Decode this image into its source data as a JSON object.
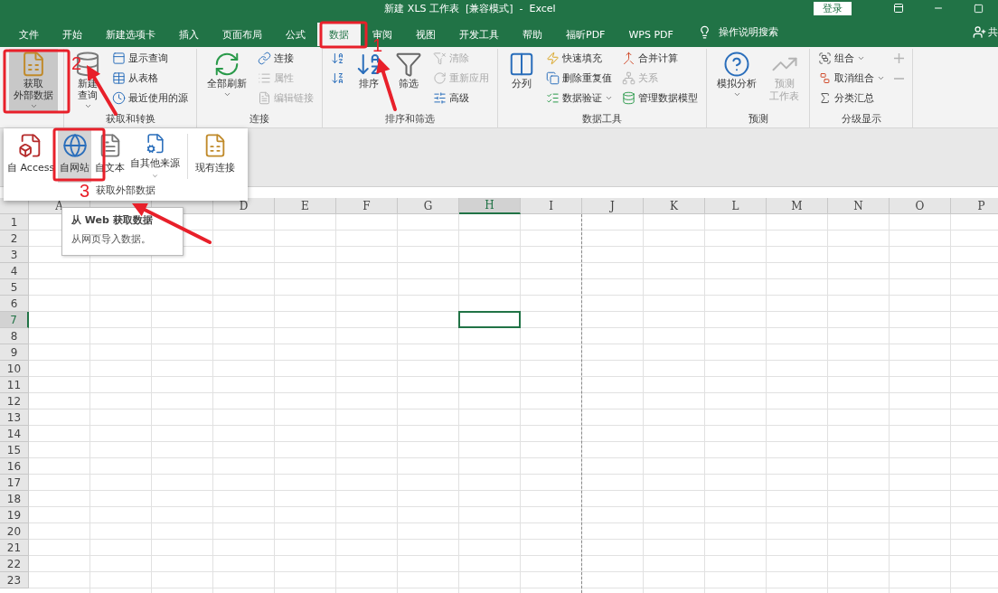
{
  "window": {
    "title": "新建 XLS 工作表  [兼容模式]  -  Excel",
    "login": "登录"
  },
  "tabs": [
    {
      "label": "文件",
      "selected": false
    },
    {
      "label": "开始",
      "selected": false
    },
    {
      "label": "新建选项卡",
      "selected": false
    },
    {
      "label": "插入",
      "selected": false
    },
    {
      "label": "页面布局",
      "selected": false
    },
    {
      "label": "公式",
      "selected": false
    },
    {
      "label": "数据",
      "selected": true
    },
    {
      "label": "审阅",
      "selected": false
    },
    {
      "label": "视图",
      "selected": false
    },
    {
      "label": "开发工具",
      "selected": false
    },
    {
      "label": "帮助",
      "selected": false
    },
    {
      "label": "福昕PDF",
      "selected": false
    },
    {
      "label": "WPS PDF",
      "selected": false
    }
  ],
  "tell_me": "操作说明搜索",
  "share": "共",
  "ribbon": [
    {
      "blocks": [
        {
          "kind": "large",
          "lines": [
            "获取",
            "外部数据"
          ],
          "dropdown": true,
          "disabled": false,
          "pressed": true
        }
      ]
    },
    {
      "label": "获取和转换",
      "blocks": [
        {
          "kind": "large",
          "lines": [
            "新建",
            "查询"
          ],
          "dropdown": true,
          "disabled": false,
          "pressed": false
        },
        {
          "kind": "stack",
          "items": [
            {
              "label": "显示查询",
              "dropdown": false,
              "disabled": false
            },
            {
              "label": "从表格",
              "dropdown": false,
              "disabled": false
            },
            {
              "label": "最近使用的源",
              "dropdown": false,
              "disabled": false
            }
          ]
        }
      ]
    },
    {
      "label": "连接",
      "blocks": [
        {
          "kind": "large",
          "lines": [
            "全部刷新"
          ],
          "dropdown": true,
          "disabled": false,
          "pressed": false
        },
        {
          "kind": "stack",
          "items": [
            {
              "label": "连接",
              "dropdown": false,
              "disabled": false
            },
            {
              "label": "属性",
              "dropdown": false,
              "disabled": true
            },
            {
              "label": "编辑链接",
              "dropdown": false,
              "disabled": true
            }
          ]
        }
      ]
    },
    {
      "label": "排序和筛选",
      "blocks": [
        {
          "kind": "stack",
          "items": [
            {
              "dropdown": false,
              "disabled": false
            },
            {
              "dropdown": false,
              "disabled": false
            }
          ]
        },
        {
          "kind": "large",
          "lines": [
            "排序"
          ],
          "dropdown": false,
          "disabled": false,
          "pressed": false
        },
        {
          "kind": "large",
          "lines": [
            "筛选"
          ],
          "dropdown": false,
          "disabled": false,
          "pressed": false
        },
        {
          "kind": "stack",
          "items": [
            {
              "label": "清除",
              "dropdown": false,
              "disabled": true
            },
            {
              "label": "重新应用",
              "dropdown": false,
              "disabled": true
            },
            {
              "label": "高级",
              "dropdown": false,
              "disabled": false
            }
          ]
        }
      ]
    },
    {
      "label": "数据工具",
      "blocks": [
        {
          "kind": "large",
          "lines": [
            "分列"
          ],
          "dropdown": false,
          "disabled": false,
          "pressed": false
        },
        {
          "kind": "stack",
          "items": [
            {
              "label": "快速填充",
              "dropdown": false,
              "disabled": false
            },
            {
              "label": "删除重复值",
              "dropdown": false,
              "disabled": false
            },
            {
              "label": "数据验证",
              "dropdown": true,
              "disabled": false
            }
          ]
        },
        {
          "kind": "stack",
          "items": [
            {
              "label": "合并计算",
              "dropdown": false,
              "disabled": false
            },
            {
              "label": "关系",
              "dropdown": false,
              "disabled": true
            },
            {
              "label": "管理数据模型",
              "dropdown": false,
              "disabled": false
            }
          ]
        }
      ]
    },
    {
      "label": "预测",
      "blocks": [
        {
          "kind": "large",
          "lines": [
            "模拟分析"
          ],
          "dropdown": true,
          "disabled": false,
          "pressed": false
        },
        {
          "kind": "large",
          "lines": [
            "预测",
            "工作表"
          ],
          "dropdown": false,
          "disabled": true,
          "pressed": false
        }
      ]
    },
    {
      "label": "分级显示",
      "blocks": [
        {
          "kind": "stack",
          "items": [
            {
              "label": "组合",
              "dropdown": true,
              "disabled": false
            },
            {
              "label": "取消组合",
              "dropdown": true,
              "disabled": false
            },
            {
              "label": "分类汇总",
              "dropdown": false,
              "disabled": false
            }
          ]
        },
        {
          "kind": "stack",
          "items": [
            {
              "dropdown": false,
              "disabled": true
            },
            {
              "dropdown": false,
              "disabled": true
            }
          ]
        }
      ]
    }
  ],
  "external_data_menu": {
    "label": "获取外部数据",
    "items": [
      {
        "label": "自 Access",
        "dropdown": false,
        "selected": false
      },
      {
        "label": "自网站",
        "dropdown": false,
        "selected": true
      },
      {
        "label": "自文本",
        "dropdown": false,
        "selected": false
      },
      {
        "label": "自其他来源",
        "dropdown": true,
        "selected": false
      },
      {
        "label": "现有连接",
        "dropdown": false,
        "selected": false
      }
    ]
  },
  "tooltip": {
    "title": "从 Web 获取数据",
    "text": "从网页导入数据。"
  },
  "sheet": {
    "columns": [
      {
        "label": "A",
        "selected": false,
        "page_break": false
      },
      {
        "selected": false,
        "page_break": false
      },
      {
        "selected": false,
        "page_break": false
      },
      {
        "label": "D",
        "selected": false,
        "page_break": false
      },
      {
        "label": "E",
        "selected": false,
        "page_break": false
      },
      {
        "label": "F",
        "selected": false,
        "page_break": false
      },
      {
        "label": "G",
        "selected": false,
        "page_break": false
      },
      {
        "label": "H",
        "selected": true,
        "page_break": false
      },
      {
        "label": "I",
        "selected": false,
        "page_break": true
      },
      {
        "label": "J",
        "selected": false,
        "page_break": false
      },
      {
        "label": "K",
        "selected": false,
        "page_break": false
      },
      {
        "label": "L",
        "selected": false,
        "page_break": false
      },
      {
        "label": "M",
        "selected": false,
        "page_break": false
      },
      {
        "label": "N",
        "selected": false,
        "page_break": false
      },
      {
        "label": "O",
        "selected": false,
        "page_break": false
      },
      {
        "label": "P",
        "selected": false,
        "page_break": false
      }
    ],
    "rows": [
      {
        "label": "1",
        "selected": false
      },
      {
        "label": "2",
        "selected": false
      },
      {
        "label": "3",
        "selected": false
      },
      {
        "label": "4",
        "selected": false
      },
      {
        "label": "5",
        "selected": false
      },
      {
        "label": "6",
        "selected": false
      },
      {
        "label": "7",
        "selected": true
      },
      {
        "label": "8",
        "selected": false
      },
      {
        "label": "9",
        "selected": false
      },
      {
        "label": "10",
        "selected": false
      },
      {
        "label": "11",
        "selected": false
      },
      {
        "label": "12",
        "selected": false
      },
      {
        "label": "13",
        "selected": false
      },
      {
        "label": "14",
        "selected": false
      },
      {
        "label": "15",
        "selected": false
      },
      {
        "label": "16",
        "selected": false
      },
      {
        "label": "17",
        "selected": false
      },
      {
        "label": "18",
        "selected": false
      },
      {
        "label": "19",
        "selected": false
      },
      {
        "label": "20",
        "selected": false
      },
      {
        "label": "21",
        "selected": false
      },
      {
        "label": "22",
        "selected": false
      },
      {
        "label": "23",
        "selected": false
      }
    ]
  },
  "annotations": [
    {
      "number": "1"
    },
    {
      "number": "2"
    },
    {
      "number": "3"
    }
  ]
}
